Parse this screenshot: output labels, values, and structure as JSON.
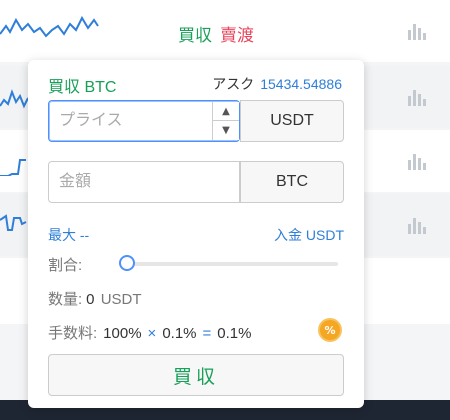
{
  "top_actions": {
    "buy": "買収",
    "sell": "賣渡"
  },
  "panel": {
    "title": "買収 BTC",
    "ask_label": "アスク",
    "ask_value": "15434.54886",
    "price_placeholder": "プライス",
    "price_unit": "USDT",
    "amount_placeholder": "金額",
    "amount_unit": "BTC",
    "max_label": "最大 --",
    "deposit_label": "入金 USDT",
    "ratio_label": "割合:",
    "ratio_value_fraction": 0,
    "quantity_label": "数量:",
    "quantity_value": "0",
    "quantity_unit": "USDT",
    "fee_label": "手数料:",
    "fee_base": "100%",
    "fee_multiply": "×",
    "fee_rate": "0.1%",
    "fee_equals": "=",
    "fee_result": "0.1%",
    "fee_badge": "%",
    "buy_button": "買収"
  },
  "colors": {
    "buy": "#18a058",
    "sell": "#e8455d",
    "link": "#2f7fd8",
    "focus": "#4d90fe",
    "badge": "#f5a623"
  },
  "icons": [
    "chevron-up-icon",
    "chevron-down-icon",
    "bar-chart-icon",
    "percent-badge-icon",
    "sparkline-icon"
  ]
}
